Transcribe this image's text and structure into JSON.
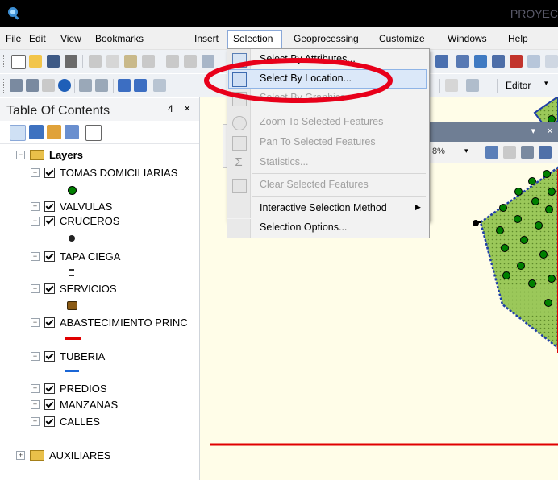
{
  "window": {
    "title": "PROYEC"
  },
  "menubar": {
    "items": [
      "File",
      "Edit",
      "View",
      "Bookmarks",
      "Insert",
      "Selection",
      "Geoprocessing",
      "Customize",
      "Windows",
      "Help"
    ],
    "open_menu": "Selection"
  },
  "selection_menu": {
    "items": [
      {
        "label": "Select By Attributes...",
        "enabled": true,
        "icon": "select-by-attributes-icon"
      },
      {
        "label": "Select By Location...",
        "enabled": true,
        "highlighted": true,
        "icon": "select-by-location-icon"
      },
      {
        "label": "Select By Graphics",
        "enabled": false,
        "icon": "select-by-graphics-icon"
      },
      {
        "label": "Zoom To Selected Features",
        "enabled": false,
        "icon": "zoom-to-selected-icon"
      },
      {
        "label": "Pan To Selected Features",
        "enabled": false,
        "icon": "pan-to-selected-icon"
      },
      {
        "label": "Statistics...",
        "enabled": false,
        "icon": "statistics-icon"
      },
      {
        "label": "Clear Selected Features",
        "enabled": false,
        "icon": "clear-selected-icon"
      },
      {
        "label": "Interactive Selection Method",
        "enabled": true,
        "submenu": true
      },
      {
        "label": "Selection Options...",
        "enabled": true
      }
    ]
  },
  "toolbar": {
    "editor_label": "Editor",
    "scale_fragment": "8%"
  },
  "toc": {
    "title": "Table Of Contents",
    "pin_glyph": "4",
    "close_glyph": "×",
    "layers": [
      {
        "label": "Layers",
        "type": "group",
        "expanded": true
      },
      {
        "label": "TOMAS DOMICILIARIAS",
        "checked": true,
        "expanded": true
      },
      {
        "label": "VALVULAS",
        "checked": true,
        "expanded": false
      },
      {
        "label": "CRUCEROS",
        "checked": true,
        "expanded": true
      },
      {
        "label": "TAPA CIEGA",
        "checked": true,
        "expanded": true
      },
      {
        "label": "SERVICIOS",
        "checked": true,
        "expanded": true
      },
      {
        "label": "ABASTECIMIENTO PRINC",
        "checked": true,
        "expanded": true
      },
      {
        "label": "TUBERIA",
        "checked": true,
        "expanded": true
      },
      {
        "label": "PREDIOS",
        "checked": true,
        "expanded": false
      },
      {
        "label": "MANZANAS",
        "checked": true,
        "expanded": false
      },
      {
        "label": "CALLES",
        "checked": true,
        "expanded": false
      },
      {
        "label": "AUXILIARES",
        "type": "group",
        "expanded": false
      }
    ]
  },
  "colors": {
    "abastecimiento_symbol": "#e00000",
    "tuberia_symbol": "#1a66d6",
    "valve_fill": "#008000",
    "map_polygon_fill": "#9bc85a",
    "highlight_ellipse": "#e8001a"
  }
}
